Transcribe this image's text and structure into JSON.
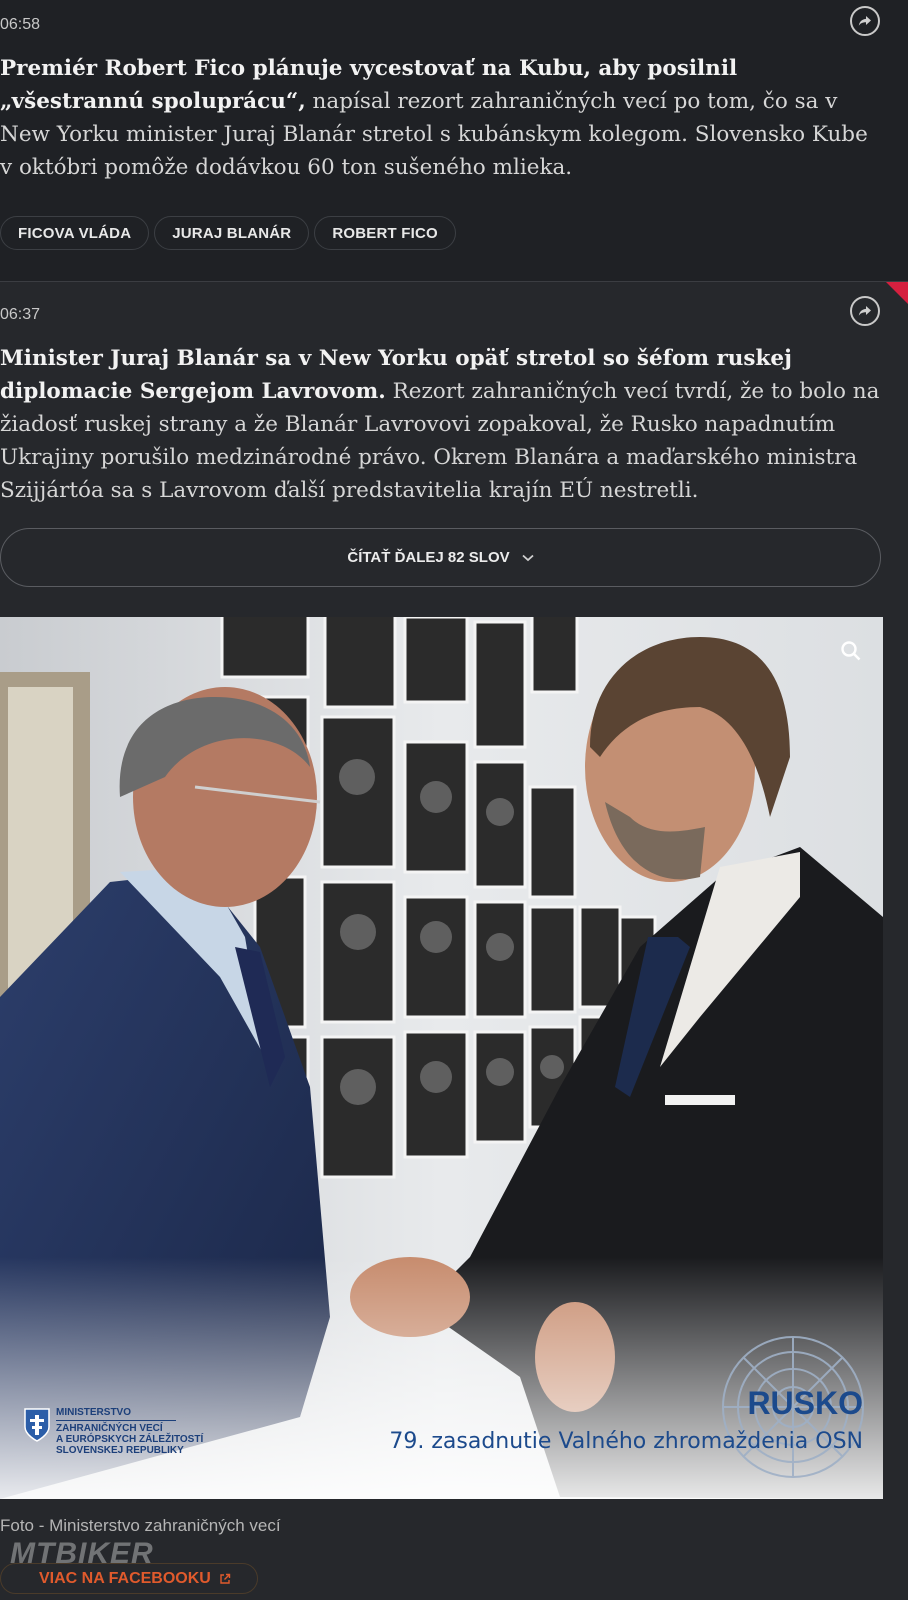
{
  "posts": [
    {
      "time": "06:58",
      "lead": "Premiér Robert Fico plánuje vycestovať na Kubu, aby posilnil „všestrannú spoluprácu“,",
      "text": " napísal rezort zahraničných vecí po tom, čo sa v New Yorku minister Juraj Blanár stretol s kubánskym kolegom. Slovensko Kube v októbri pomôže dodávkou 60 ton sušeného mlieka.",
      "tags": [
        "FICOVA VLÁDA",
        "JURAJ BLANÁR",
        "ROBERT FICO"
      ],
      "share_icon": "share-arrow-icon"
    },
    {
      "time": "06:37",
      "lead": "Minister Juraj Blanár sa v New Yorku opäť stretol so šéfom ruskej diplomacie Sergejom Lavrovom.",
      "text": " Rezort zahraničných vecí tvrdí, že to bolo na žiadosť ruskej strany a že Blanár Lavrovovi zopakoval, že Rusko napadnutím Ukrajiny porušilo medzinárodné právo. Okrem Blanára a maďarského ministra Szijjártóa sa s Lavrovom ďalší predstavitelia krajín EÚ nestretli.",
      "read_more": "ČÍTAŤ ĎALEJ 82 SLOV",
      "share_icon": "share-arrow-icon"
    }
  ],
  "photo": {
    "ministry_logo": [
      "MINISTERSTVO",
      "ZAHRANIČNÝCH VECÍ",
      "A EURÓPSKYCH ZÁLEŽITOSTÍ",
      "SLOVENSKEJ REPUBLIKY"
    ],
    "country": "RUSKO",
    "event": "79. zasadnutie Valného zhromaždenia OSN",
    "caption": "Foto - Ministerstvo zahraničných vecí"
  },
  "facebook_link": "VIAC NA FACEBOOKU",
  "watermark": "MTBIKER",
  "colors": {
    "accent_red": "#d5203f",
    "facebook_orange": "#e05a2c",
    "un_blue": "#1c4a8c"
  }
}
